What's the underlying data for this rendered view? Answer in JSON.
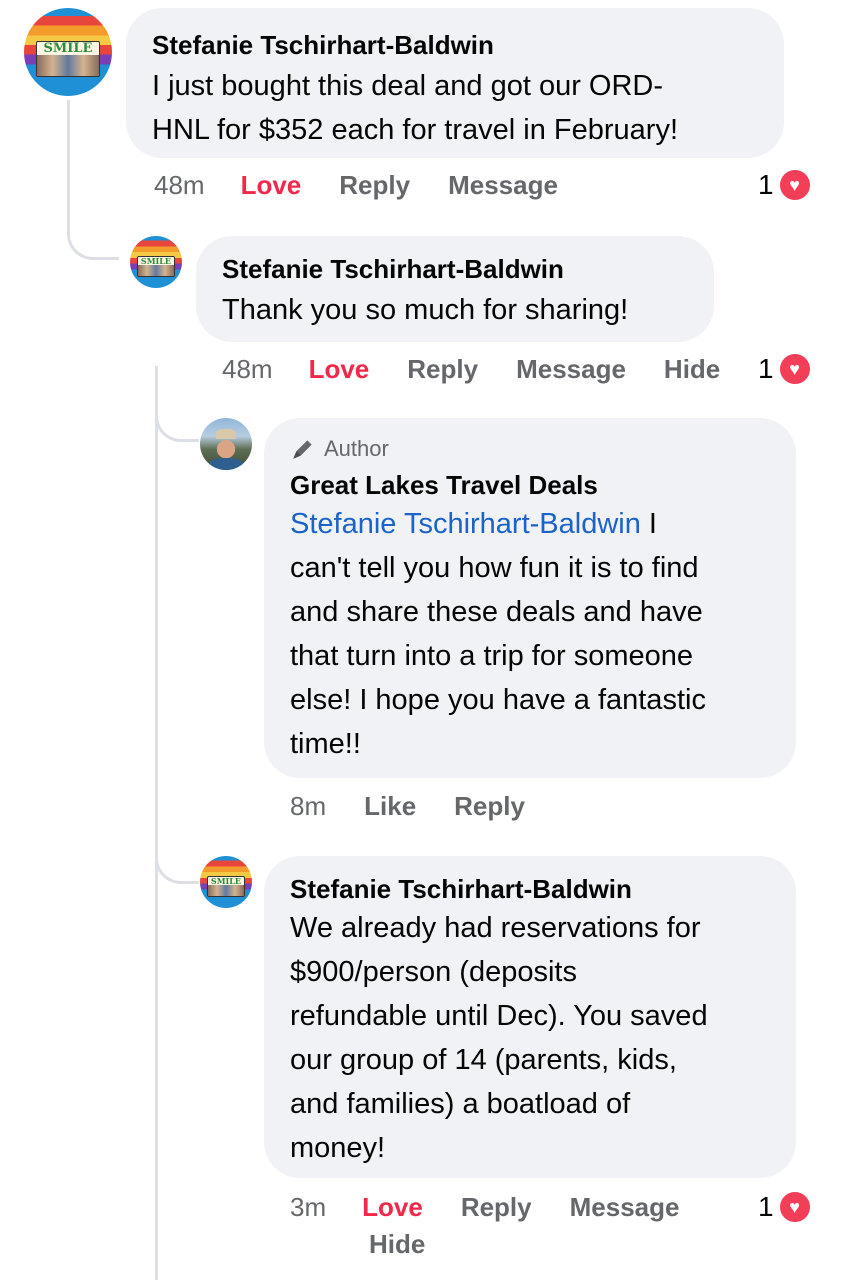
{
  "comments": [
    {
      "name": "Stefanie Tschirhart-Baldwin",
      "text_lines": [
        "I just bought this deal and got our ORD-",
        "HNL for $352 each for travel in February!"
      ],
      "time": "48m",
      "actions": [
        "Love",
        "Reply",
        "Message"
      ],
      "reaction_count": "1"
    },
    {
      "name": "Stefanie Tschirhart-Baldwin",
      "text_lines": [
        "Thank you so much for sharing!"
      ],
      "time": "48m",
      "actions": [
        "Love",
        "Reply",
        "Message",
        "Hide"
      ],
      "reaction_count": "1"
    },
    {
      "badge": "Author",
      "name": "Great Lakes Travel Deals",
      "mention": "Stefanie Tschirhart-Baldwin",
      "text_lines": [
        " I",
        "can't tell you how fun it is to find",
        "and share these deals and have",
        "that turn into a trip for someone",
        "else! I hope you have a fantastic",
        "time!!"
      ],
      "time": "8m",
      "actions": [
        "Like",
        "Reply"
      ]
    },
    {
      "name": "Stefanie Tschirhart-Baldwin",
      "text_lines": [
        "We already had reservations for",
        "$900/person (deposits",
        "refundable until Dec). You saved",
        "our group of 14 (parents, kids,",
        "and families) a boatload of",
        "money!"
      ],
      "time": "3m",
      "actions": [
        "Love",
        "Reply",
        "Message",
        "Hide"
      ],
      "reaction_count": "1"
    }
  ],
  "avatar_sign_text": "SMILE",
  "icons": {
    "author_badge": "pencil-icon",
    "reaction": "heart-icon"
  },
  "colors": {
    "bubble": "#f0f2f5",
    "love": "#f0284a",
    "mention": "#1b62c9",
    "muted": "#65676b",
    "heart": "#f33e58"
  }
}
